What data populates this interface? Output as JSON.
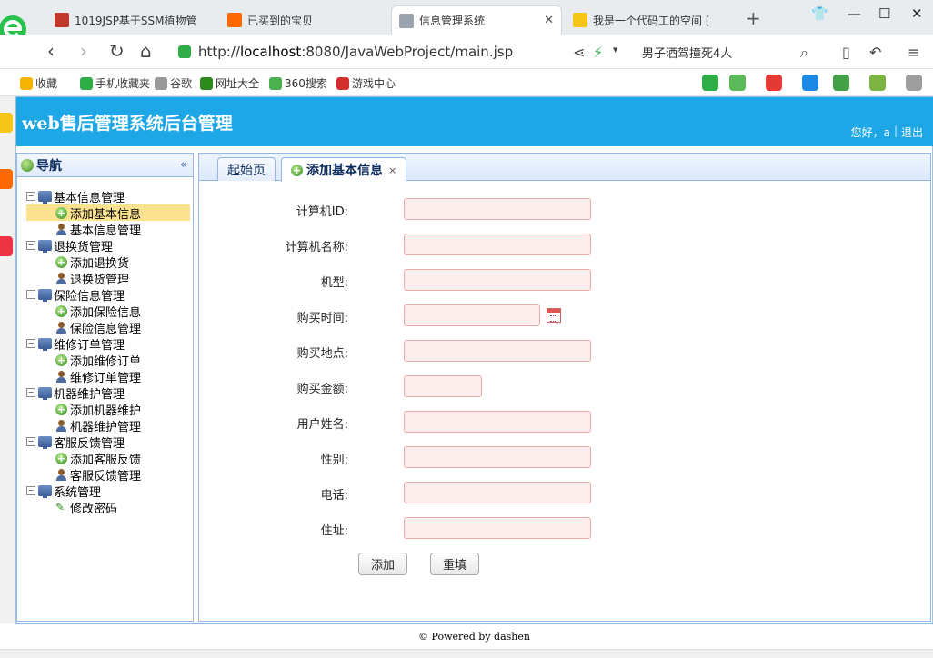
{
  "browser": {
    "tabs": [
      {
        "title": "1019JSP基于SSM植物管",
        "active": false,
        "favicon_color": "#c0392b"
      },
      {
        "title": "已买到的宝贝",
        "active": false,
        "favicon_color": "#ff6a00"
      },
      {
        "title": "信息管理系统",
        "active": true,
        "favicon_color": "#9aa4ae"
      },
      {
        "title": "我是一个代码工的空间 [",
        "active": false,
        "favicon_color": "#f5c518"
      }
    ],
    "url_prefix": "http://",
    "url_host": "localhost",
    "url_path": ":8080/JavaWebProject/main.jsp",
    "search_text": "男子酒驾撞死4人",
    "bookmarks": [
      {
        "label": "收藏",
        "color": "#f5b400"
      },
      {
        "label": "手机收藏夹",
        "color": "#2fae48"
      },
      {
        "label": "谷歌",
        "color": "#999999"
      },
      {
        "label": "网址大全",
        "color": "#2f8a1d"
      },
      {
        "label": "360搜索",
        "color": "#4caf50"
      },
      {
        "label": "游戏中心",
        "color": "#d32f2f"
      }
    ]
  },
  "app": {
    "title": "web售后管理系统后台管理",
    "greeting": "您好，a",
    "logout": "退出",
    "nav_title": "导航",
    "collapse_glyph": "«",
    "tree": [
      {
        "label": "基本信息管理",
        "type": "group"
      },
      {
        "label": "添加基本信息",
        "type": "add",
        "selected": true
      },
      {
        "label": "基本信息管理",
        "type": "user"
      },
      {
        "label": "退换货管理",
        "type": "group"
      },
      {
        "label": "添加退换货",
        "type": "add"
      },
      {
        "label": "退换货管理",
        "type": "user"
      },
      {
        "label": "保险信息管理",
        "type": "group"
      },
      {
        "label": "添加保险信息",
        "type": "add"
      },
      {
        "label": "保险信息管理",
        "type": "user"
      },
      {
        "label": "维修订单管理",
        "type": "group"
      },
      {
        "label": "添加维修订单",
        "type": "add"
      },
      {
        "label": "维修订单管理",
        "type": "user"
      },
      {
        "label": "机器维护管理",
        "type": "group"
      },
      {
        "label": "添加机器维护",
        "type": "add"
      },
      {
        "label": "机器维护管理",
        "type": "user"
      },
      {
        "label": "客服反馈管理",
        "type": "group"
      },
      {
        "label": "添加客服反馈",
        "type": "add"
      },
      {
        "label": "客服反馈管理",
        "type": "user"
      },
      {
        "label": "系统管理",
        "type": "group"
      },
      {
        "label": "修改密码",
        "type": "pen"
      }
    ],
    "tabs": [
      {
        "label": "起始页",
        "active": false
      },
      {
        "label": "添加基本信息",
        "active": true,
        "close": "×"
      }
    ],
    "form": {
      "fields": [
        {
          "label": "计算机ID:",
          "value": "",
          "kind": "text"
        },
        {
          "label": "计算机名称:",
          "value": "",
          "kind": "text"
        },
        {
          "label": "机型:",
          "value": "",
          "kind": "text"
        },
        {
          "label": "购买时间:",
          "value": "",
          "kind": "date"
        },
        {
          "label": "购买地点:",
          "value": "",
          "kind": "text"
        },
        {
          "label": "购买金额:",
          "value": "",
          "kind": "short"
        },
        {
          "label": "用户姓名:",
          "value": "",
          "kind": "text"
        },
        {
          "label": "性别:",
          "value": "",
          "kind": "text"
        },
        {
          "label": "电话:",
          "value": "",
          "kind": "text"
        },
        {
          "label": "住址:",
          "value": "",
          "kind": "text"
        }
      ],
      "submit_label": "添加",
      "reset_label": "重填"
    },
    "footer": "© Powered by dashen"
  }
}
